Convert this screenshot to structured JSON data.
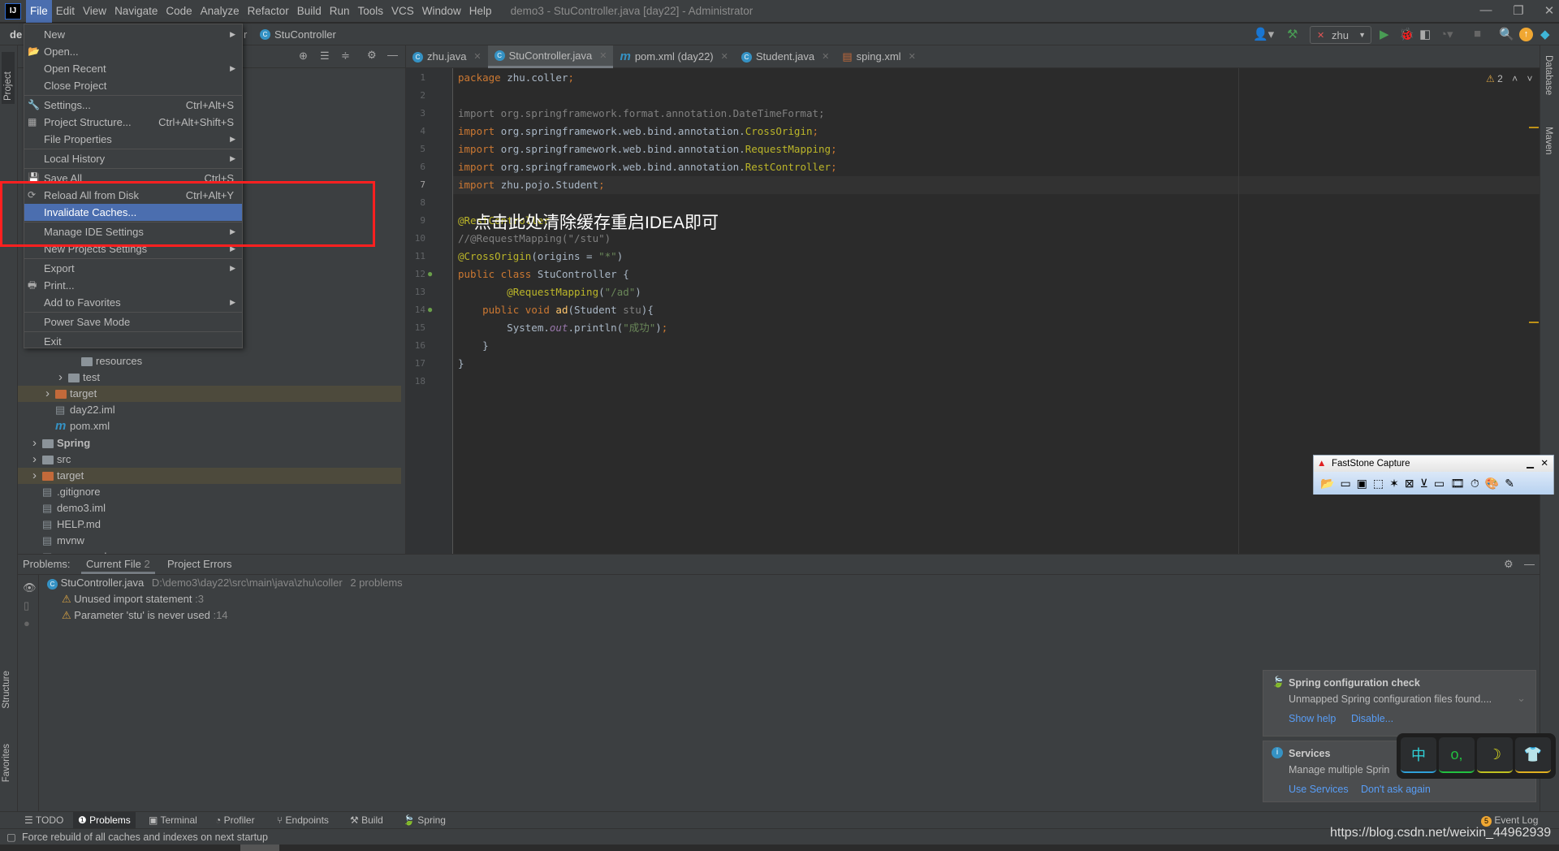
{
  "titlebar": {
    "logo": "IJ",
    "menu": [
      "File",
      "Edit",
      "View",
      "Navigate",
      "Code",
      "Analyze",
      "Refactor",
      "Build",
      "Run",
      "Tools",
      "VCS",
      "Window",
      "Help"
    ],
    "title": "demo3 - StuController.java [day22] - Administrator"
  },
  "navbar": {
    "project_fragment": "de",
    "crumb_sep": "r",
    "class_name": "StuController",
    "run_config": "zhu"
  },
  "file_menu": {
    "items": [
      {
        "label": "New",
        "submenu": true
      },
      {
        "label": "Open...",
        "icon": "folder-open-icon"
      },
      {
        "label": "Open Recent",
        "submenu": true
      },
      {
        "label": "Close Project",
        "sep_after": true
      },
      {
        "label": "Settings...",
        "shortcut": "Ctrl+Alt+S",
        "icon": "wrench-icon"
      },
      {
        "label": "Project Structure...",
        "shortcut": "Ctrl+Alt+Shift+S",
        "icon": "project-structure-icon"
      },
      {
        "label": "File Properties",
        "submenu": true,
        "sep_after": true
      },
      {
        "label": "Local History",
        "submenu": true,
        "sep_after": true
      },
      {
        "label": "Save All",
        "shortcut": "Ctrl+S",
        "icon": "save-icon"
      },
      {
        "label": "Reload All from Disk",
        "shortcut": "Ctrl+Alt+Y",
        "icon": "reload-icon"
      },
      {
        "label": "Invalidate Caches...",
        "selected": true,
        "sep_after": true
      },
      {
        "label": "Manage IDE Settings",
        "submenu": true
      },
      {
        "label": "New Projects Settings",
        "submenu": true,
        "sep_after": true
      },
      {
        "label": "Export",
        "submenu": true
      },
      {
        "label": "Print...",
        "icon": "print-icon"
      },
      {
        "label": "Add to Favorites",
        "submenu": true,
        "sep_after": true
      },
      {
        "label": "Power Save Mode",
        "sep_after": true
      },
      {
        "label": "Exit"
      }
    ]
  },
  "annotation": "点击此处清除缓存重启IDEA即可",
  "project_tree": [
    {
      "label": "resources",
      "indent": 5,
      "kind": "resources"
    },
    {
      "label": "test",
      "indent": 4,
      "kind": "folder",
      "arrow": true
    },
    {
      "label": "target",
      "indent": 3,
      "kind": "excluded",
      "arrow": true
    },
    {
      "label": "day22.iml",
      "indent": 3,
      "kind": "file"
    },
    {
      "label": "pom.xml",
      "indent": 3,
      "kind": "maven"
    },
    {
      "label": "Spring",
      "indent": 2,
      "kind": "module",
      "arrow": true,
      "bold": true
    },
    {
      "label": "src",
      "indent": 2,
      "kind": "folder",
      "arrow": true
    },
    {
      "label": "target",
      "indent": 2,
      "kind": "excluded",
      "arrow": true
    },
    {
      "label": ".gitignore",
      "indent": 2,
      "kind": "file"
    },
    {
      "label": "demo3.iml",
      "indent": 2,
      "kind": "file"
    },
    {
      "label": "HELP.md",
      "indent": 2,
      "kind": "file"
    },
    {
      "label": "mvnw",
      "indent": 2,
      "kind": "file"
    },
    {
      "label": "mvnw.cmd",
      "indent": 2,
      "kind": "file"
    }
  ],
  "editor_tabs": [
    {
      "label": "zhu.java",
      "icon": "class-icon"
    },
    {
      "label": "StuController.java",
      "icon": "class-icon",
      "active": true
    },
    {
      "label": "pom.xml (day22)",
      "icon": "maven-icon"
    },
    {
      "label": "Student.java",
      "icon": "class-icon"
    },
    {
      "label": "sping.xml",
      "icon": "xml-icon"
    }
  ],
  "inspection": {
    "warnings": "2"
  },
  "code": [
    [
      {
        "t": "package ",
        "c": "kw"
      },
      {
        "t": "zhu.coller"
      },
      {
        "t": ";",
        "c": "kw"
      }
    ],
    [],
    [
      {
        "t": "import org.springframework.format.annotation.DateTimeFormat;",
        "c": "unused"
      }
    ],
    [
      {
        "t": "import ",
        "c": "kw"
      },
      {
        "t": "org.springframework.web.bind.annotation."
      },
      {
        "t": "CrossOrigin",
        "c": "ann"
      },
      {
        "t": ";",
        "c": "kw"
      }
    ],
    [
      {
        "t": "import ",
        "c": "kw"
      },
      {
        "t": "org.springframework.web.bind.annotation."
      },
      {
        "t": "RequestMapping",
        "c": "ann"
      },
      {
        "t": ";",
        "c": "kw"
      }
    ],
    [
      {
        "t": "import ",
        "c": "kw"
      },
      {
        "t": "org.springframework.web.bind.annotation."
      },
      {
        "t": "RestController",
        "c": "ann"
      },
      {
        "t": ";",
        "c": "kw"
      }
    ],
    [
      {
        "t": "import ",
        "c": "kw"
      },
      {
        "t": "zhu.pojo.Student"
      },
      {
        "t": ";",
        "c": "kw"
      }
    ],
    [],
    [
      {
        "t": "@RestController",
        "c": "ann"
      }
    ],
    [
      {
        "t": "//@RequestMapping(\"/stu\")",
        "c": "cmt"
      }
    ],
    [
      {
        "t": "@CrossOrigin",
        "c": "ann"
      },
      {
        "t": "(origins = "
      },
      {
        "t": "\"*\"",
        "c": "str"
      },
      {
        "t": ")"
      }
    ],
    [
      {
        "t": "public class ",
        "c": "kw"
      },
      {
        "t": "StuController {"
      }
    ],
    [
      {
        "t": "        "
      },
      {
        "t": "@RequestMapping",
        "c": "ann"
      },
      {
        "t": "("
      },
      {
        "t": "\"/ad\"",
        "c": "str"
      },
      {
        "t": ")"
      }
    ],
    [
      {
        "t": "    "
      },
      {
        "t": "public void ",
        "c": "kw"
      },
      {
        "t": "ad",
        "c": "fn"
      },
      {
        "t": "(Student "
      },
      {
        "t": "stu",
        "c": "par"
      },
      {
        "t": "){"
      }
    ],
    [
      {
        "t": "        System."
      },
      {
        "t": "out",
        "c": "fld"
      },
      {
        "t": ".println("
      },
      {
        "t": "\"成功\"",
        "c": "str"
      },
      {
        "t": ")"
      },
      {
        "t": ";",
        "c": "kw"
      }
    ],
    [
      {
        "t": "    }"
      }
    ],
    [
      {
        "t": "}"
      }
    ],
    []
  ],
  "problems": {
    "label": "Problems:",
    "tabs": [
      {
        "label": "Current File",
        "count": "2",
        "active": true
      },
      {
        "label": "Project Errors"
      }
    ],
    "file": "StuController.java",
    "path": "D:\\demo3\\day22\\src\\main\\java\\zhu\\coller",
    "count_text": "2 problems",
    "items": [
      {
        "text": "Unused import statement",
        "line": ":3"
      },
      {
        "text": "Parameter 'stu' is never used",
        "line": ":14"
      }
    ]
  },
  "left_tools": [
    "Project",
    "Structure",
    "Favorites"
  ],
  "right_tools": [
    "Database",
    "Maven"
  ],
  "bottom_tabs": [
    {
      "label": "TODO",
      "icon": "list-icon"
    },
    {
      "label": "Problems",
      "icon": "problems-icon",
      "active": true
    },
    {
      "label": "Terminal",
      "icon": "terminal-icon"
    },
    {
      "label": "Profiler",
      "icon": "profiler-icon"
    },
    {
      "label": "Endpoints",
      "icon": "endpoints-icon"
    },
    {
      "label": "Build",
      "icon": "hammer-icon"
    },
    {
      "label": "Spring",
      "icon": "spring-icon"
    }
  ],
  "event_log": {
    "label": "Event Log",
    "count": "5"
  },
  "status": "Force rebuild of all caches and indexes on next startup",
  "notifications": [
    {
      "title": "Spring configuration check",
      "body": "Unmapped Spring configuration files found....",
      "links": [
        "Show help",
        "Disable..."
      ]
    },
    {
      "title": "Services",
      "body": "Manage multiple Sprin",
      "links": [
        "Use Services",
        "Don't ask again"
      ]
    }
  ],
  "faststone": {
    "title": "FastStone Capture"
  },
  "ime": {
    "keys": [
      "中",
      "o,",
      "☽",
      "👕"
    ]
  },
  "watermark": "https://blog.csdn.net/weixin_44962939"
}
